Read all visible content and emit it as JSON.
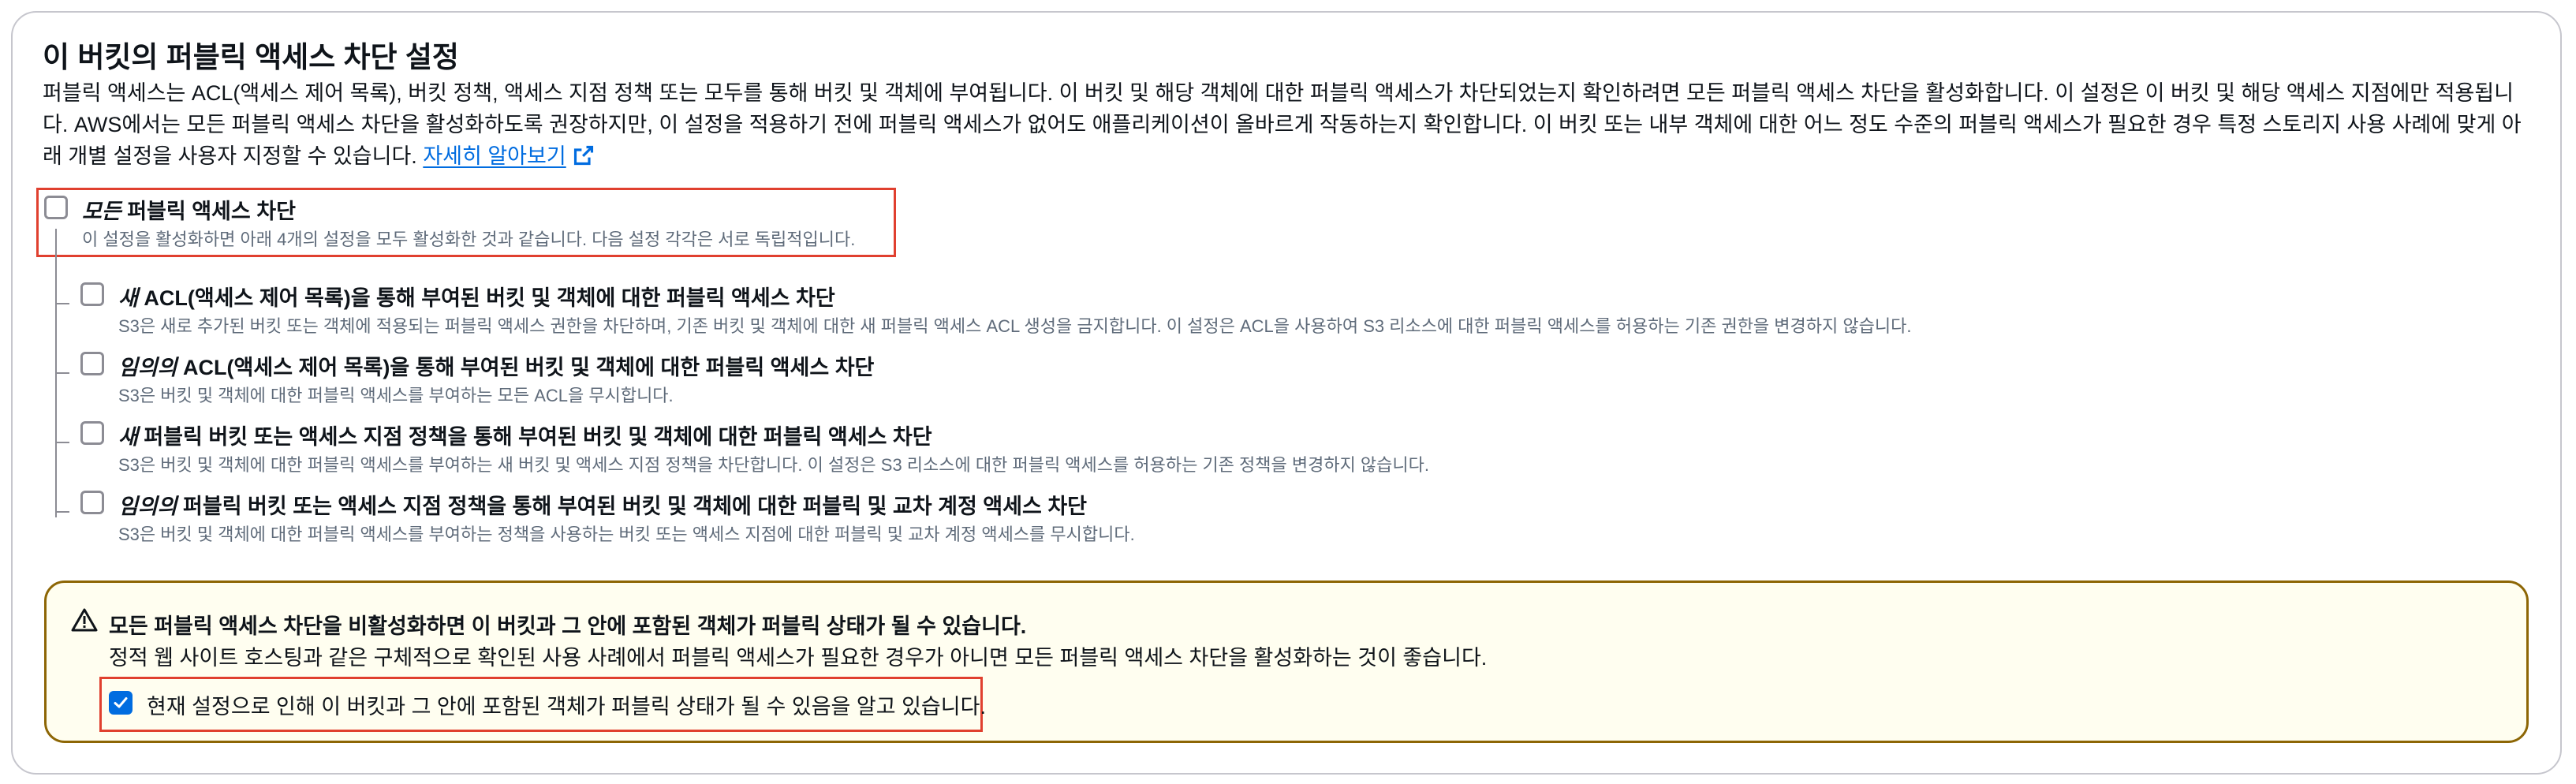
{
  "section": {
    "title": "이 버킷의 퍼블릭 액세스 차단 설정",
    "description": "퍼블릭 액세스는 ACL(액세스 제어 목록), 버킷 정책, 액세스 지점 정책 또는 모두를 통해 버킷 및 객체에 부여됩니다. 이 버킷 및 해당 객체에 대한 퍼블릭 액세스가 차단되었는지 확인하려면 모든 퍼블릭 액세스 차단을 활성화합니다. 이 설정은 이 버킷 및 해당 액세스 지점에만 적용됩니다. AWS에서는 모든 퍼블릭 액세스 차단을 활성화하도록 권장하지만, 이 설정을 적용하기 전에 퍼블릭 액세스가 없어도 애플리케이션이 올바르게 작동하는지 확인합니다. 이 버킷 또는 내부 객체에 대한 어느 정도 수준의 퍼블릭 액세스가 필요한 경우 특정 스토리지 사용 사례에 맞게 아래 개별 설정을 사용자 지정할 수 있습니다.",
    "learn_more": "자세히 알아보기"
  },
  "block_all": {
    "label_emph": "모든",
    "label_rest": " 퍼블릭 액세스 차단",
    "description": "이 설정을 활성화하면 아래 4개의 설정을 모두 활성화한 것과 같습니다. 다음 설정 각각은 서로 독립적입니다.",
    "checked": false
  },
  "options": [
    {
      "label_emph": "새",
      "label_rest": " ACL(액세스 제어 목록)을 통해 부여된 버킷 및 객체에 대한 퍼블릭 액세스 차단",
      "description": "S3은 새로 추가된 버킷 또는 객체에 적용되는 퍼블릭 액세스 권한을 차단하며, 기존 버킷 및 객체에 대한 새 퍼블릭 액세스 ACL 생성을 금지합니다. 이 설정은 ACL을 사용하여 S3 리소스에 대한 퍼블릭 액세스를 허용하는 기존 권한을 변경하지 않습니다.",
      "checked": false
    },
    {
      "label_emph": "임의의",
      "label_rest": " ACL(액세스 제어 목록)을 통해 부여된 버킷 및 객체에 대한 퍼블릭 액세스 차단",
      "description": "S3은 버킷 및 객체에 대한 퍼블릭 액세스를 부여하는 모든 ACL을 무시합니다.",
      "checked": false
    },
    {
      "label_emph": "새",
      "label_rest": " 퍼블릭 버킷 또는 액세스 지점 정책을 통해 부여된 버킷 및 객체에 대한 퍼블릭 액세스 차단",
      "description": "S3은 버킷 및 객체에 대한 퍼블릭 액세스를 부여하는 새 버킷 및 액세스 지점 정책을 차단합니다. 이 설정은 S3 리소스에 대한 퍼블릭 액세스를 허용하는 기존 정책을 변경하지 않습니다.",
      "checked": false
    },
    {
      "label_emph": "임의의",
      "label_rest": " 퍼블릭 버킷 또는 액세스 지점 정책을 통해 부여된 버킷 및 객체에 대한 퍼블릭 및 교차 계정 액세스 차단",
      "description": "S3은 버킷 및 객체에 대한 퍼블릭 액세스를 부여하는 정책을 사용하는 버킷 또는 액세스 지점에 대한 퍼블릭 및 교차 계정 액세스를 무시합니다.",
      "checked": false
    }
  ],
  "warning": {
    "icon": "warning-icon",
    "title": "모든 퍼블릭 액세스 차단을 비활성화하면 이 버킷과 그 안에 포함된 객체가 퍼블릭 상태가 될 수 있습니다.",
    "body": "정적 웹 사이트 호스팅과 같은 구체적으로 확인된 사용 사례에서 퍼블릭 액세스가 필요한 경우가 아니면 모든 퍼블릭 액세스 차단을 활성화하는 것이 좋습니다.",
    "acknowledge_label": "현재 설정으로 인해 이 버킷과 그 안에 포함된 객체가 퍼블릭 상태가 될 수 있음을 알고 있습니다.",
    "acknowledge_checked": true
  },
  "colors": {
    "accent": "#006ce0",
    "highlight": "#e0402f",
    "warning_border": "#8d6605",
    "warning_bg": "#fffef0"
  }
}
